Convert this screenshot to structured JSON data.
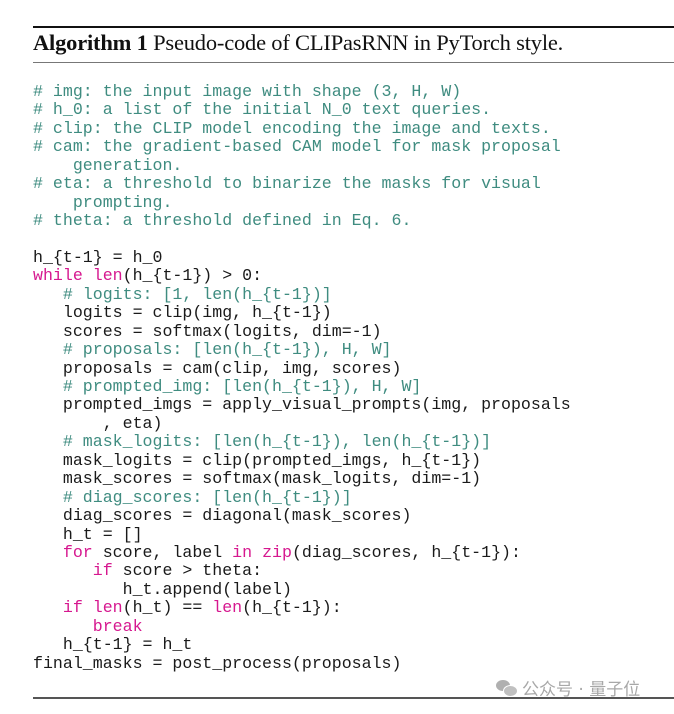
{
  "caption": {
    "label": "Algorithm 1",
    "text": " Pseudo-code of CLIPasRNN in PyTorch style."
  },
  "code_lines": [
    [
      {
        "t": "cm",
        "s": "# img: the input image with shape (3, H, W)"
      }
    ],
    [
      {
        "t": "cm",
        "s": "# h_0: a list of the initial N_0 text queries."
      }
    ],
    [
      {
        "t": "cm",
        "s": "# clip: the CLIP model encoding the image and texts."
      }
    ],
    [
      {
        "t": "cm",
        "s": "# cam: the gradient-based CAM model for mask proposal"
      }
    ],
    [
      {
        "t": "cm",
        "s": "    generation."
      }
    ],
    [
      {
        "t": "cm",
        "s": "# eta: a threshold to binarize the masks for visual"
      }
    ],
    [
      {
        "t": "cm",
        "s": "    prompting."
      }
    ],
    [
      {
        "t": "cm",
        "s": "# theta: a threshold defined in Eq. 6."
      }
    ],
    [
      {
        "t": "tx",
        "s": ""
      }
    ],
    [
      {
        "t": "tx",
        "s": "h_{t-1} = h_0"
      }
    ],
    [
      {
        "t": "kw",
        "s": "while"
      },
      {
        "t": "tx",
        "s": " "
      },
      {
        "t": "kw",
        "s": "len"
      },
      {
        "t": "tx",
        "s": "(h_{t-1}) > 0:"
      }
    ],
    [
      {
        "t": "tx",
        "s": "   "
      },
      {
        "t": "cm",
        "s": "# logits: [1, len(h_{t-1})]"
      }
    ],
    [
      {
        "t": "tx",
        "s": "   logits = clip(img, h_{t-1})"
      }
    ],
    [
      {
        "t": "tx",
        "s": "   scores = softmax(logits, dim=-1)"
      }
    ],
    [
      {
        "t": "tx",
        "s": "   "
      },
      {
        "t": "cm",
        "s": "# proposals: [len(h_{t-1}), H, W]"
      }
    ],
    [
      {
        "t": "tx",
        "s": "   proposals = cam(clip, img, scores)"
      }
    ],
    [
      {
        "t": "tx",
        "s": "   "
      },
      {
        "t": "cm",
        "s": "# prompted_img: [len(h_{t-1}), H, W]"
      }
    ],
    [
      {
        "t": "tx",
        "s": "   prompted_imgs = apply_visual_prompts(img, proposals"
      }
    ],
    [
      {
        "t": "tx",
        "s": "       , eta)"
      }
    ],
    [
      {
        "t": "tx",
        "s": "   "
      },
      {
        "t": "cm",
        "s": "# mask_logits: [len(h_{t-1}), len(h_{t-1})]"
      }
    ],
    [
      {
        "t": "tx",
        "s": "   mask_logits = clip(prompted_imgs, h_{t-1})"
      }
    ],
    [
      {
        "t": "tx",
        "s": "   mask_scores = softmax(mask_logits, dim=-1)"
      }
    ],
    [
      {
        "t": "tx",
        "s": "   "
      },
      {
        "t": "cm",
        "s": "# diag_scores: [len(h_{t-1})]"
      }
    ],
    [
      {
        "t": "tx",
        "s": "   diag_scores = diagonal(mask_scores)"
      }
    ],
    [
      {
        "t": "tx",
        "s": "   h_t = []"
      }
    ],
    [
      {
        "t": "tx",
        "s": "   "
      },
      {
        "t": "kw",
        "s": "for"
      },
      {
        "t": "tx",
        "s": " score, label "
      },
      {
        "t": "kw",
        "s": "in"
      },
      {
        "t": "tx",
        "s": " "
      },
      {
        "t": "kw",
        "s": "zip"
      },
      {
        "t": "tx",
        "s": "(diag_scores, h_{t-1}):"
      }
    ],
    [
      {
        "t": "tx",
        "s": "      "
      },
      {
        "t": "kw",
        "s": "if"
      },
      {
        "t": "tx",
        "s": " score > theta:"
      }
    ],
    [
      {
        "t": "tx",
        "s": "         h_t.append(label)"
      }
    ],
    [
      {
        "t": "tx",
        "s": "   "
      },
      {
        "t": "kw",
        "s": "if"
      },
      {
        "t": "tx",
        "s": " "
      },
      {
        "t": "kw",
        "s": "len"
      },
      {
        "t": "tx",
        "s": "(h_t) == "
      },
      {
        "t": "kw",
        "s": "len"
      },
      {
        "t": "tx",
        "s": "(h_{t-1}):"
      }
    ],
    [
      {
        "t": "tx",
        "s": "      "
      },
      {
        "t": "kw",
        "s": "break"
      }
    ],
    [
      {
        "t": "tx",
        "s": "   h_{t-1} = h_t"
      }
    ],
    [
      {
        "t": "tx",
        "s": "final_masks = post_process(proposals)"
      }
    ]
  ],
  "watermark": {
    "icon": "wechat-icon",
    "text": "公众号 · 量子位"
  },
  "colors": {
    "comment": "#3f8c80",
    "keyword": "#d6188f",
    "text": "#1a1a1a"
  }
}
